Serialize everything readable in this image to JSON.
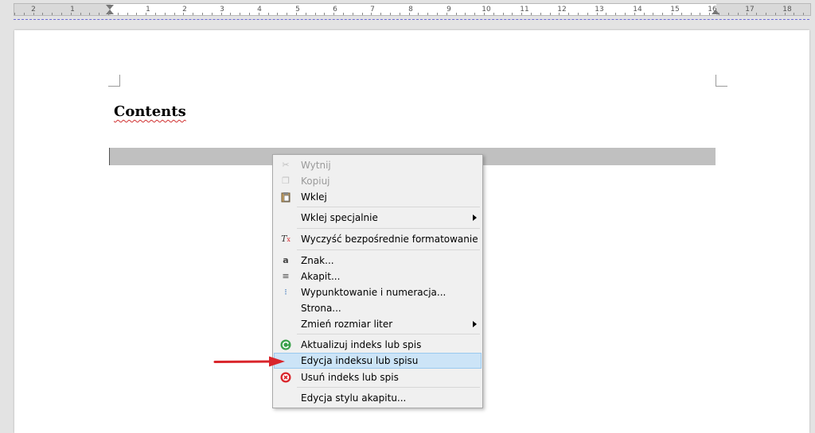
{
  "ruler": {
    "numbers": [
      "2",
      "1",
      "1",
      "2",
      "3",
      "4",
      "5",
      "6",
      "7",
      "8",
      "9",
      "10",
      "11",
      "12",
      "13",
      "14",
      "15",
      "16",
      "17",
      "18"
    ]
  },
  "document": {
    "heading": "Contents"
  },
  "context_menu": {
    "items": [
      {
        "label": "Wytnij",
        "icon": "scissors-icon",
        "disabled": true
      },
      {
        "label": "Kopiuj",
        "icon": "copy-icon",
        "disabled": true
      },
      {
        "label": "Wklej",
        "icon": "paste-icon",
        "disabled": false
      },
      {
        "label": "Wklej specjalnie",
        "submenu": true
      },
      {
        "label": "Wyczyść bezpośrednie formatowanie",
        "icon": "clear-formatting-icon"
      },
      {
        "label": "Znak...",
        "icon": "character-icon"
      },
      {
        "label": "Akapit...",
        "icon": "paragraph-icon"
      },
      {
        "label": "Wypunktowanie i numeracja...",
        "icon": "bullets-numbering-icon"
      },
      {
        "label": "Strona..."
      },
      {
        "label": "Zmień rozmiar liter",
        "submenu": true
      },
      {
        "label": "Aktualizuj indeks lub spis",
        "icon": "update-icon"
      },
      {
        "label": "Edycja indeksu lub spisu",
        "selected": true
      },
      {
        "label": "Usuń indeks lub spis",
        "icon": "delete-icon"
      },
      {
        "label": "Edycja stylu akapitu..."
      }
    ]
  },
  "colors": {
    "selection_bg": "#cce4f7",
    "annotation_arrow": "#d9252b",
    "update_icon": "#3aa14a",
    "delete_icon": "#d9252b"
  }
}
